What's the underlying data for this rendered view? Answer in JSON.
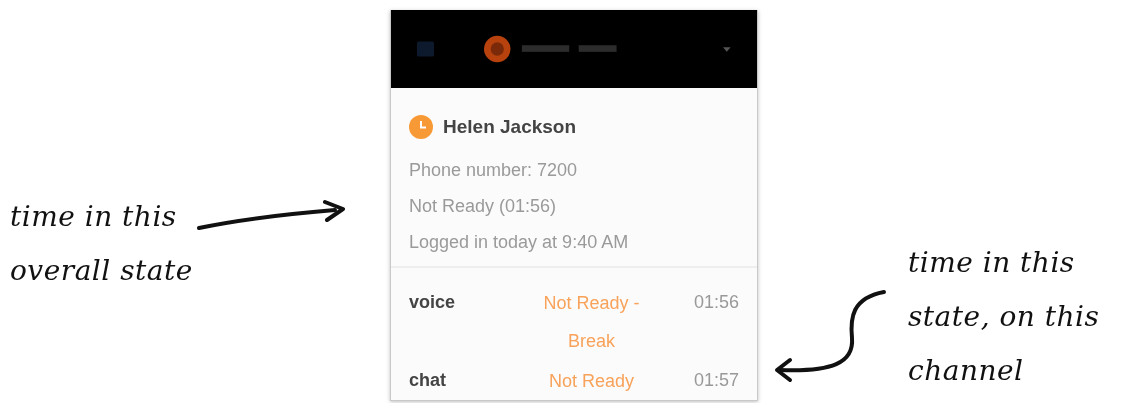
{
  "left_annotation": {
    "lines": [
      "time in this",
      "overall state"
    ]
  },
  "right_annotation": {
    "lines": [
      "time in this",
      "state, on this",
      "channel"
    ]
  },
  "agent": {
    "name": "Helen Jackson",
    "details": [
      "Phone number: 7200",
      "Not Ready (01:56)",
      "Logged in today at 9:40 AM"
    ]
  },
  "channels": [
    {
      "name": "voice",
      "status": "Not Ready - Break",
      "time": "01:56"
    },
    {
      "name": "chat",
      "status": "Not Ready",
      "time": "01:57"
    }
  ]
}
